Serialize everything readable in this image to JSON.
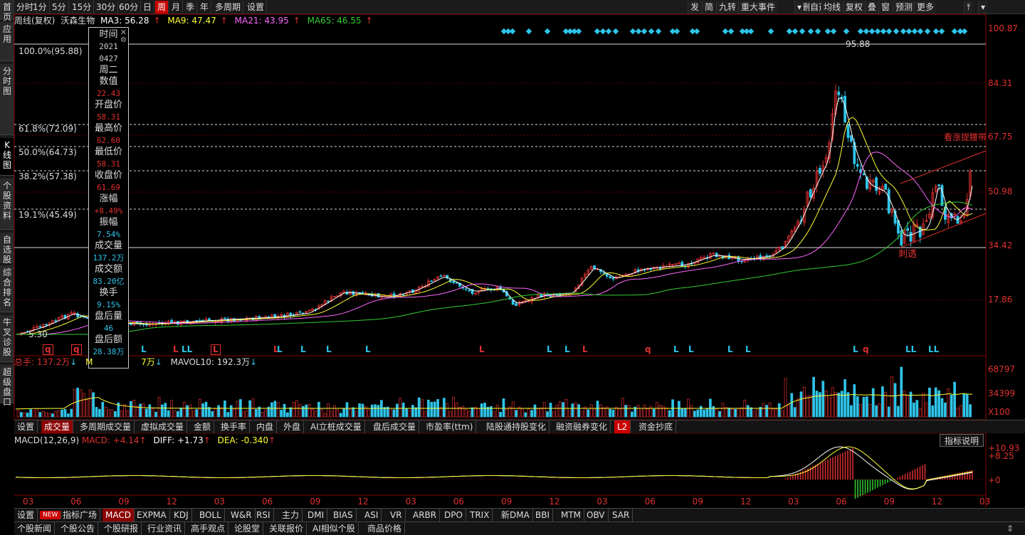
{
  "sidebar": [
    "首页",
    "应用",
    "分时图",
    "K线图",
    "个股资料",
    "自选股",
    "综合排名",
    "牛叉诊股",
    "超级盘口"
  ],
  "toolbar": {
    "periods": [
      "分时",
      "1分",
      "5分",
      "15分",
      "30分",
      "60分",
      "日",
      "周",
      "月",
      "季",
      "年",
      "多周期",
      "设置"
    ],
    "active_period": "周",
    "right": [
      "发",
      "简",
      "九转",
      "重大事件",
      "删自选",
      "均线",
      "复权",
      "叠",
      "窗",
      "预测",
      "更多"
    ]
  },
  "ma_row": {
    "title": "周线(复权)",
    "stock": "沃森生物",
    "ma3": "MA3: 56.28",
    "ma9": "MA9: 47.47",
    "ma21": "MA21: 43.95",
    "ma65": "MA65: 46.55"
  },
  "fib": [
    "100.0%(95.88)",
    "61.8%(72.09)",
    "50.0%(64.73)",
    "38.2%(57.38)",
    "19.1%(45.49)"
  ],
  "price_axis": [
    "100.87",
    "84.31",
    "67.75",
    "50.98",
    "34.42",
    "17.86"
  ],
  "annotations": {
    "high": "95.88",
    "low_left": "5.30",
    "channel": "看涨提腰带",
    "pierce": "刺透"
  },
  "tooltip": [
    {
      "h": "时间",
      "v": "2021",
      "v2": "0427",
      "c": "#cccccc"
    },
    {
      "h": "周二",
      "v": "",
      "c": "#cccccc"
    },
    {
      "h": "数值",
      "v": "22.43",
      "c": "#e03030"
    },
    {
      "h": "开盘价",
      "v": "58.31",
      "c": "#e03030"
    },
    {
      "h": "最高价",
      "v": "62.60",
      "c": "#e03030"
    },
    {
      "h": "最低价",
      "v": "58.31",
      "c": "#e03030"
    },
    {
      "h": "收盘价",
      "v": "61.69",
      "c": "#e03030"
    },
    {
      "h": "涨幅",
      "v": "+8.49%",
      "c": "#e03030"
    },
    {
      "h": "振幅",
      "v": "7.54%",
      "c": "#2ec4e8"
    },
    {
      "h": "成交量",
      "v": "137.2万",
      "c": "#2ec4e8"
    },
    {
      "h": "成交额",
      "v": "83.20亿",
      "c": "#2ec4e8"
    },
    {
      "h": "换手",
      "v": "9.15%",
      "c": "#2ec4e8"
    },
    {
      "h": "盘后量",
      "v": "46",
      "c": "#2ec4e8"
    },
    {
      "h": "盘后额",
      "v": "28.38万",
      "c": "#2ec4e8"
    }
  ],
  "volume_row": {
    "total": "总手: 137.2万",
    "mavol5_tail": "7万",
    "mavol10": "MAVOL10: 192.3万",
    "axis": [
      "68797",
      "34399",
      "X100"
    ]
  },
  "vol_tabs": [
    "设置",
    "成交量",
    "多周期成交量",
    "虚拟成交量",
    "金额",
    "换手率",
    "内盘",
    "外盘",
    "AI立桩成交量",
    "盘后成交量",
    "市盈率(ttm)",
    "陆股通持股变化",
    "融资融券变化",
    "L2",
    "资金抄底"
  ],
  "vol_tabs_active": "成交量",
  "macd_row": {
    "name": "MACD(12,26,9)",
    "macd": "MACD: +4.14",
    "diff": "DIFF: +1.73",
    "dea": "DEA: -0.340",
    "help": "指标说明",
    "axis": [
      "+10.93",
      "+8.25",
      "+0"
    ]
  },
  "months": [
    "03",
    "06",
    "09",
    "12",
    "03",
    "06",
    "09",
    "12",
    "03",
    "06",
    "09",
    "12",
    "03",
    "06",
    "09",
    "12",
    "03",
    "06",
    "09",
    "12",
    "03"
  ],
  "indicator_tabs": [
    "设置",
    "NEW",
    "指标广场",
    "MACD",
    "EXPMA",
    "KDJ",
    "BOLL",
    "W&R",
    "RSI",
    "主力",
    "DMI",
    "BIAS",
    "ASI",
    "VR",
    "ARBR",
    "DPO",
    "TRIX",
    "新DMA",
    "BBI",
    "MTM",
    "OBV",
    "SAR"
  ],
  "indicator_active": "MACD",
  "news_tabs": [
    "个股新闻",
    "个股公告",
    "个股研报",
    "行业资讯",
    "高手观点",
    "论股堂",
    "关联报价",
    "AI相似个股",
    "商品价格"
  ],
  "colors": {
    "up": "#e03030",
    "down": "#2ec4e8",
    "ma3": "#ffffff",
    "ma9": "#ffff33",
    "ma21": "#ff66ff",
    "ma65": "#33cc33"
  }
}
